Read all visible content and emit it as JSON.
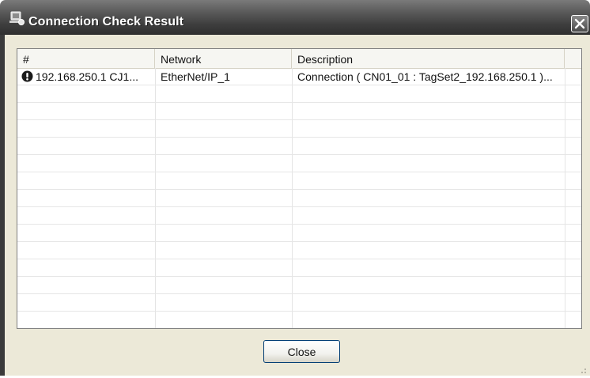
{
  "window": {
    "title": "Connection Check Result"
  },
  "table": {
    "columns": [
      "#",
      "Network",
      "Description"
    ],
    "rows": [
      {
        "id": "192.168.250.1 CJ1...",
        "network": "EtherNet/IP_1",
        "description": "Connection ( CN01_01 : TagSet2_192.168.250.1 )..."
      }
    ]
  },
  "buttons": {
    "close_label": "Close"
  },
  "icons": {
    "title": "network-check-icon",
    "row": "warning-icon",
    "close": "close-icon"
  }
}
